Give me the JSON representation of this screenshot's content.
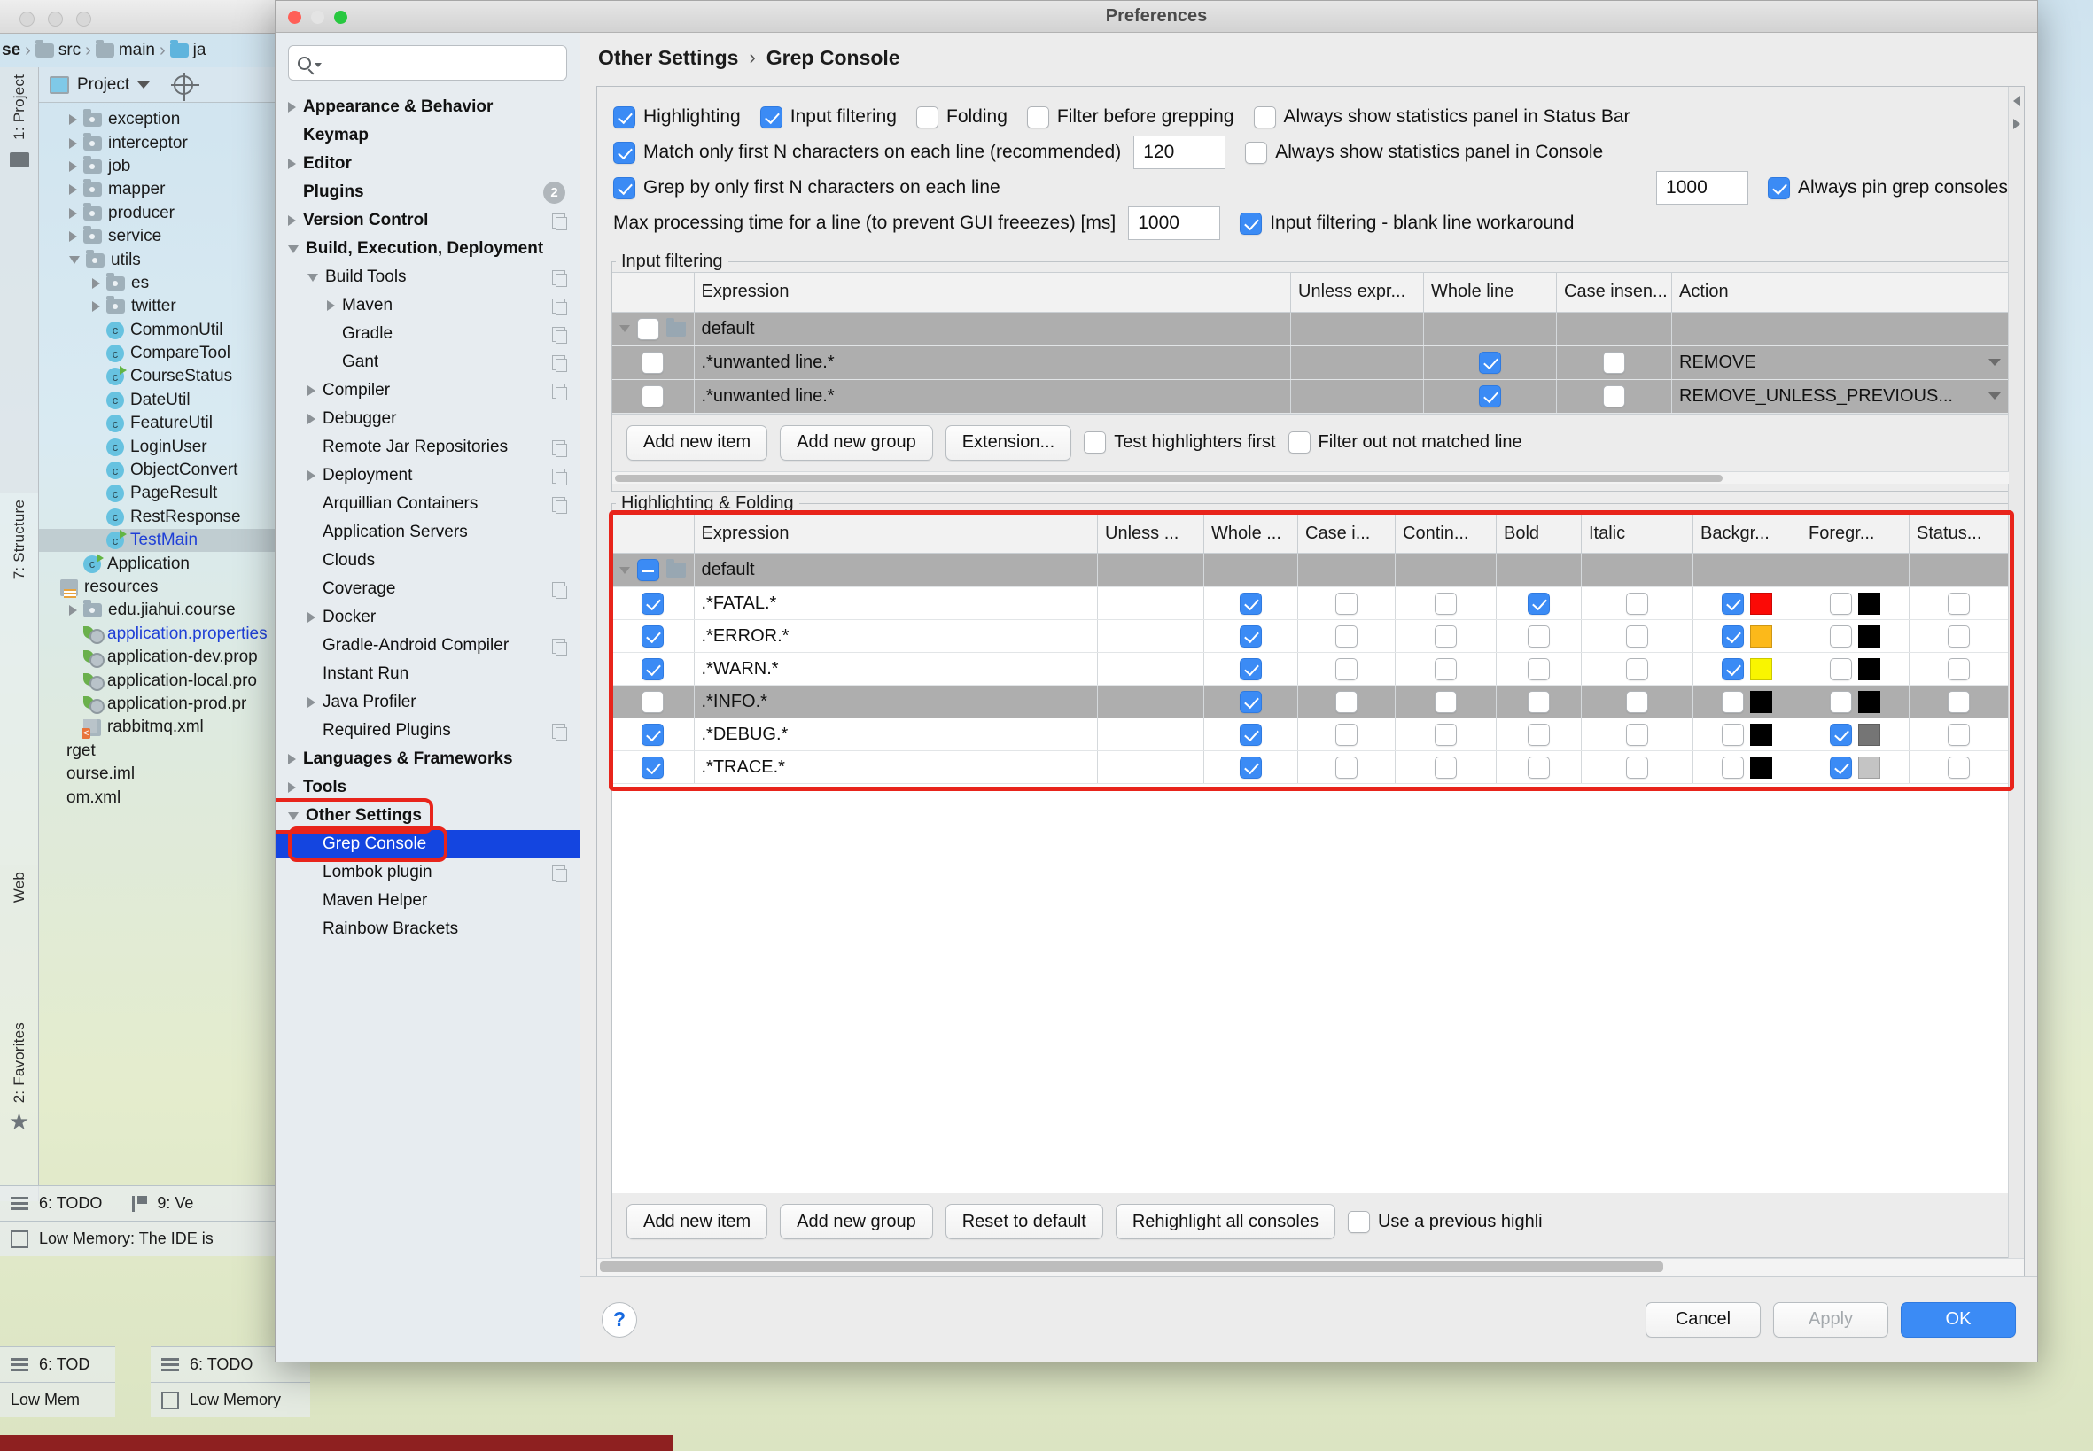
{
  "ide": {
    "breadcrumb": [
      "se",
      "src",
      "main",
      "ja"
    ],
    "project_panel_title": "Project",
    "left_strips": [
      {
        "label": "1: Project"
      },
      {
        "label": "7: Structure"
      },
      {
        "label": "Web"
      },
      {
        "label": "2: Favorites"
      }
    ],
    "tree": [
      {
        "label": "exception",
        "type": "folder",
        "arrow": "right",
        "indent": 1
      },
      {
        "label": "interceptor",
        "type": "folder",
        "arrow": "right",
        "indent": 1
      },
      {
        "label": "job",
        "type": "folder",
        "arrow": "right",
        "indent": 1
      },
      {
        "label": "mapper",
        "type": "folder",
        "arrow": "right",
        "indent": 1
      },
      {
        "label": "producer",
        "type": "folder",
        "arrow": "right",
        "indent": 1
      },
      {
        "label": "service",
        "type": "folder",
        "arrow": "right",
        "indent": 1
      },
      {
        "label": "utils",
        "type": "folder",
        "arrow": "down",
        "indent": 1
      },
      {
        "label": "es",
        "type": "folder",
        "arrow": "right",
        "indent": 2
      },
      {
        "label": "twitter",
        "type": "folder",
        "arrow": "right",
        "indent": 2
      },
      {
        "label": "CommonUtil",
        "type": "class",
        "arrow": "none",
        "indent": 2
      },
      {
        "label": "CompareTool",
        "type": "class",
        "arrow": "none",
        "indent": 2
      },
      {
        "label": "CourseStatus",
        "type": "class-run",
        "arrow": "none",
        "indent": 2
      },
      {
        "label": "DateUtil",
        "type": "class",
        "arrow": "none",
        "indent": 2
      },
      {
        "label": "FeatureUtil",
        "type": "class",
        "arrow": "none",
        "indent": 2
      },
      {
        "label": "LoginUser",
        "type": "class",
        "arrow": "none",
        "indent": 2
      },
      {
        "label": "ObjectConvert",
        "type": "class",
        "arrow": "none",
        "indent": 2
      },
      {
        "label": "PageResult",
        "type": "class",
        "arrow": "none",
        "indent": 2
      },
      {
        "label": "RestResponse",
        "type": "class",
        "arrow": "none",
        "indent": 2
      },
      {
        "label": "TestMain",
        "type": "class-run",
        "arrow": "none",
        "indent": 2,
        "selected": true,
        "blue": true
      },
      {
        "label": "Application",
        "type": "class-run",
        "arrow": "none",
        "indent": 1
      },
      {
        "label": "resources",
        "type": "resources",
        "arrow": "none",
        "indent": 0
      },
      {
        "label": "edu.jiahui.course",
        "type": "folder",
        "arrow": "right",
        "indent": 1
      },
      {
        "label": "application.properties",
        "type": "prop",
        "arrow": "none",
        "indent": 1,
        "blue": true
      },
      {
        "label": "application-dev.prop",
        "type": "prop",
        "arrow": "none",
        "indent": 1
      },
      {
        "label": "application-local.pro",
        "type": "prop",
        "arrow": "none",
        "indent": 1
      },
      {
        "label": "application-prod.pr",
        "type": "prop",
        "arrow": "none",
        "indent": 1
      },
      {
        "label": "rabbitmq.xml",
        "type": "xml",
        "arrow": "none",
        "indent": 1
      },
      {
        "label": "rget",
        "type": "plain",
        "arrow": "none",
        "indent": 0
      },
      {
        "label": "ourse.iml",
        "type": "plain",
        "arrow": "none",
        "indent": 0
      },
      {
        "label": "om.xml",
        "type": "plain",
        "arrow": "none",
        "indent": 0
      }
    ],
    "statusbars": [
      {
        "todo": "6: TODO",
        "vcs": "9: Ve",
        "memory": "Low Memory: The IDE is"
      },
      {
        "todo": "6: TOD",
        "memory": "Low Mem"
      },
      {
        "todo": "6: TODO",
        "memory": "Low Memory"
      }
    ]
  },
  "prefs": {
    "window_title": "Preferences",
    "search": {
      "placeholder": "",
      "value": ""
    },
    "breadcrumb": {
      "parent": "Other Settings",
      "separator": "›",
      "current": "Grep Console"
    },
    "tree_items": [
      {
        "label": "Appearance & Behavior",
        "arrow": "right",
        "bold": true,
        "indent": 0
      },
      {
        "label": "Keymap",
        "arrow": "none",
        "bold": true,
        "indent": 0
      },
      {
        "label": "Editor",
        "arrow": "right",
        "bold": true,
        "indent": 0
      },
      {
        "label": "Plugins",
        "arrow": "none",
        "bold": true,
        "indent": 0,
        "badge": "2"
      },
      {
        "label": "Version Control",
        "arrow": "right",
        "bold": true,
        "indent": 0,
        "copy": true
      },
      {
        "label": "Build, Execution, Deployment",
        "arrow": "down",
        "bold": true,
        "indent": 0
      },
      {
        "label": "Build Tools",
        "arrow": "down",
        "bold": false,
        "indent": 1,
        "copy": true
      },
      {
        "label": "Maven",
        "arrow": "right",
        "bold": false,
        "indent": 2,
        "copy": true
      },
      {
        "label": "Gradle",
        "arrow": "none",
        "bold": false,
        "indent": 2,
        "copy": true
      },
      {
        "label": "Gant",
        "arrow": "none",
        "bold": false,
        "indent": 2,
        "copy": true
      },
      {
        "label": "Compiler",
        "arrow": "right",
        "bold": false,
        "indent": 1,
        "copy": true
      },
      {
        "label": "Debugger",
        "arrow": "right",
        "bold": false,
        "indent": 1
      },
      {
        "label": "Remote Jar Repositories",
        "arrow": "none",
        "bold": false,
        "indent": 1,
        "copy": true
      },
      {
        "label": "Deployment",
        "arrow": "right",
        "bold": false,
        "indent": 1,
        "copy": true
      },
      {
        "label": "Arquillian Containers",
        "arrow": "none",
        "bold": false,
        "indent": 1,
        "copy": true
      },
      {
        "label": "Application Servers",
        "arrow": "none",
        "bold": false,
        "indent": 1
      },
      {
        "label": "Clouds",
        "arrow": "none",
        "bold": false,
        "indent": 1
      },
      {
        "label": "Coverage",
        "arrow": "none",
        "bold": false,
        "indent": 1,
        "copy": true
      },
      {
        "label": "Docker",
        "arrow": "right",
        "bold": false,
        "indent": 1
      },
      {
        "label": "Gradle-Android Compiler",
        "arrow": "none",
        "bold": false,
        "indent": 1,
        "copy": true
      },
      {
        "label": "Instant Run",
        "arrow": "none",
        "bold": false,
        "indent": 1
      },
      {
        "label": "Java Profiler",
        "arrow": "right",
        "bold": false,
        "indent": 1
      },
      {
        "label": "Required Plugins",
        "arrow": "none",
        "bold": false,
        "indent": 1,
        "copy": true
      },
      {
        "label": "Languages & Frameworks",
        "arrow": "right",
        "bold": true,
        "indent": 0
      },
      {
        "label": "Tools",
        "arrow": "right",
        "bold": true,
        "indent": 0
      },
      {
        "label": "Other Settings",
        "arrow": "down",
        "bold": true,
        "indent": 0,
        "highlighted": true
      },
      {
        "label": "Grep Console",
        "arrow": "none",
        "bold": false,
        "indent": 1,
        "selected": true,
        "highlighted": true
      },
      {
        "label": "Lombok plugin",
        "arrow": "none",
        "bold": false,
        "indent": 1,
        "copy": true
      },
      {
        "label": "Maven Helper",
        "arrow": "none",
        "bold": false,
        "indent": 1
      },
      {
        "label": "Rainbow Brackets",
        "arrow": "none",
        "bold": false,
        "indent": 1
      }
    ],
    "options": {
      "row1": [
        {
          "label": "Highlighting",
          "checked": true
        },
        {
          "label": "Input filtering",
          "checked": true
        },
        {
          "label": "Folding",
          "checked": false
        },
        {
          "label": "Filter before grepping",
          "checked": false
        },
        {
          "label": "Always show statistics panel in Status Bar",
          "checked": false
        }
      ],
      "row2": {
        "label": "Match only first N characters on each line (recommended)",
        "checked": true,
        "value": "120",
        "right_label": "Always show statistics panel in Console",
        "right_checked": false
      },
      "row3": {
        "label": "Grep by only first N characters on each line",
        "checked": true,
        "value": "1000",
        "right_label": "Always pin grep consoles",
        "right_checked": true
      },
      "row4": {
        "label": "Max processing time for a line (to prevent GUI freeezes) [ms]",
        "value": "1000",
        "right_label": "Input filtering - blank line workaround",
        "right_checked": true
      }
    },
    "input_filtering": {
      "legend": "Input filtering",
      "columns": [
        "",
        "Expression",
        "Unless expr...",
        "Whole line",
        "Case insen...",
        "Action"
      ],
      "rows": [
        {
          "kind": "group",
          "enabled": false,
          "expression": "default",
          "unless": "",
          "whole_line": null,
          "case_insensitive": null,
          "action": ""
        },
        {
          "kind": "item",
          "enabled": false,
          "expression": ".*unwanted line.*",
          "unless": "",
          "whole_line": true,
          "case_insensitive": false,
          "action": "REMOVE"
        },
        {
          "kind": "item",
          "enabled": false,
          "expression": ".*unwanted line.*",
          "unless": "",
          "whole_line": true,
          "case_insensitive": false,
          "action": "REMOVE_UNLESS_PREVIOUS..."
        }
      ],
      "buttons": [
        "Add new item",
        "Add new group",
        "Extension..."
      ],
      "checkboxes": [
        {
          "label": "Test highlighters first",
          "checked": false
        },
        {
          "label": "Filter out not matched line",
          "checked": false
        }
      ]
    },
    "highlighting": {
      "legend": "Highlighting & Folding",
      "columns": [
        "",
        "Expression",
        "Unless ...",
        "Whole ...",
        "Case i...",
        "Contin...",
        "Bold",
        "Italic",
        "Backgr...",
        "Foregr...",
        "Status..."
      ],
      "rows": [
        {
          "kind": "group",
          "enabled": "mixed",
          "expression": "default",
          "whole_line": null,
          "case_insensitive": null,
          "continue": null,
          "bold": null,
          "italic": null,
          "bg_on": null,
          "bg_color": "",
          "fg_on": null,
          "fg_color": "",
          "status": null,
          "selected": false
        },
        {
          "kind": "item",
          "enabled": true,
          "expression": ".*FATAL.*",
          "whole_line": true,
          "case_insensitive": false,
          "continue": false,
          "bold": true,
          "italic": false,
          "bg_on": true,
          "bg_color": "#fb0a06",
          "fg_on": false,
          "fg_color": "#000000",
          "status": false,
          "selected": false
        },
        {
          "kind": "item",
          "enabled": true,
          "expression": ".*ERROR.*",
          "whole_line": true,
          "case_insensitive": false,
          "continue": false,
          "bold": false,
          "italic": false,
          "bg_on": true,
          "bg_color": "#fcb91a",
          "fg_on": false,
          "fg_color": "#000000",
          "status": false,
          "selected": false
        },
        {
          "kind": "item",
          "enabled": true,
          "expression": ".*WARN.*",
          "whole_line": true,
          "case_insensitive": false,
          "continue": false,
          "bold": false,
          "italic": false,
          "bg_on": true,
          "bg_color": "#f9f500",
          "fg_on": false,
          "fg_color": "#000000",
          "status": false,
          "selected": false
        },
        {
          "kind": "item",
          "enabled": false,
          "expression": ".*INFO.*",
          "whole_line": true,
          "case_insensitive": false,
          "continue": false,
          "bold": false,
          "italic": false,
          "bg_on": false,
          "bg_color": "#000000",
          "fg_on": false,
          "fg_color": "#000000",
          "status": false,
          "selected": true
        },
        {
          "kind": "item",
          "enabled": true,
          "expression": ".*DEBUG.*",
          "whole_line": true,
          "case_insensitive": false,
          "continue": false,
          "bold": false,
          "italic": false,
          "bg_on": false,
          "bg_color": "#000000",
          "fg_on": true,
          "fg_color": "#757575",
          "status": false,
          "selected": false
        },
        {
          "kind": "item",
          "enabled": true,
          "expression": ".*TRACE.*",
          "whole_line": true,
          "case_insensitive": false,
          "continue": false,
          "bold": false,
          "italic": false,
          "bg_on": false,
          "bg_color": "#000000",
          "fg_on": true,
          "fg_color": "#c4c4c4",
          "status": false,
          "selected": false
        }
      ],
      "buttons": [
        "Add new item",
        "Add new group",
        "Reset to default",
        "Rehighlight all consoles"
      ],
      "checkbox": {
        "label": "Use a previous highli",
        "checked": false
      }
    },
    "footer": {
      "help": "?",
      "cancel": "Cancel",
      "apply": "Apply",
      "ok": "OK"
    },
    "accent": "#3b8bf5",
    "highlight_ring": "#e8241b",
    "selection": "#1445e0"
  }
}
